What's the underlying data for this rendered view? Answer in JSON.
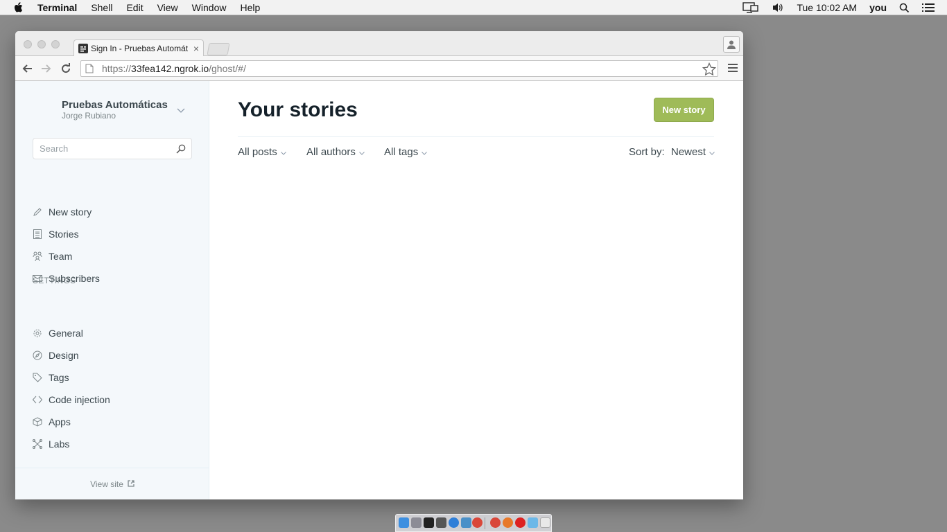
{
  "menubar": {
    "app": "Terminal",
    "items": [
      "Shell",
      "Edit",
      "View",
      "Window",
      "Help"
    ],
    "clock": "Tue 10:02 AM",
    "user": "you",
    "icons": [
      "apple-icon",
      "display-icon",
      "volume-icon",
      "spotlight-search-icon",
      "notification-list-icon"
    ]
  },
  "browser": {
    "tab_title": "Sign In - Pruebas Automáticas",
    "url_scheme": "https://",
    "url_host": "33fea142.ngrok.io",
    "url_path": "/ghost/#/"
  },
  "sidebar": {
    "blog_title": "Pruebas Automáticas",
    "user_name": "Jorge Rubiano",
    "search_placeholder": "Search",
    "nav": [
      {
        "label": "New story",
        "icon": "pencil-icon"
      },
      {
        "label": "Stories",
        "icon": "stories-icon"
      },
      {
        "label": "Team",
        "icon": "team-icon"
      },
      {
        "label": "Subscribers",
        "icon": "mail-icon"
      }
    ],
    "settings_heading": "SETTINGS",
    "settings": [
      {
        "label": "General",
        "icon": "gear-icon"
      },
      {
        "label": "Design",
        "icon": "compass-icon"
      },
      {
        "label": "Tags",
        "icon": "tag-icon"
      },
      {
        "label": "Code injection",
        "icon": "code-icon"
      },
      {
        "label": "Apps",
        "icon": "box-icon"
      },
      {
        "label": "Labs",
        "icon": "labs-icon"
      }
    ],
    "view_site": "View site"
  },
  "main": {
    "title": "Your stories",
    "new_story_button": "New story",
    "filters": {
      "posts": "All posts",
      "authors": "All authors",
      "tags": "All tags",
      "sort_label": "Sort by:",
      "sort_value": "Newest"
    }
  },
  "colors": {
    "accent_green": "#9fbb58",
    "sidebar_bg": "#f4f8fb",
    "text_dark": "#15212a"
  }
}
